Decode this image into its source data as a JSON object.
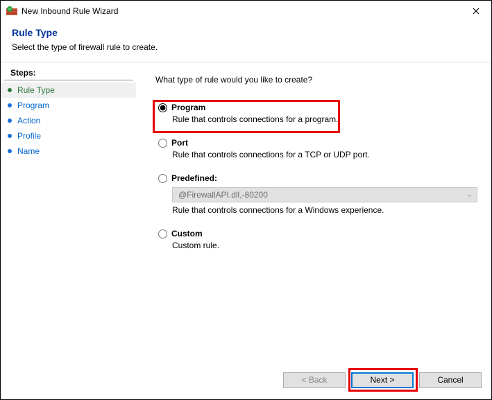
{
  "window": {
    "title": "New Inbound Rule Wizard"
  },
  "header": {
    "title": "Rule Type",
    "subtitle": "Select the type of firewall rule to create."
  },
  "sidebar": {
    "title": "Steps:",
    "items": [
      {
        "label": "Rule Type",
        "active": true,
        "link": false
      },
      {
        "label": "Program",
        "active": false,
        "link": true
      },
      {
        "label": "Action",
        "active": false,
        "link": true
      },
      {
        "label": "Profile",
        "active": false,
        "link": true
      },
      {
        "label": "Name",
        "active": false,
        "link": true
      }
    ]
  },
  "content": {
    "question": "What type of rule would you like to create?",
    "options": {
      "program": {
        "title": "Program",
        "desc": "Rule that controls connections for a program."
      },
      "port": {
        "title": "Port",
        "desc": "Rule that controls connections for a TCP or UDP port."
      },
      "predefined": {
        "title": "Predefined:",
        "dropdown": "@FirewallAPI.dll,-80200",
        "desc": "Rule that controls connections for a Windows experience."
      },
      "custom": {
        "title": "Custom",
        "desc": "Custom rule."
      }
    }
  },
  "footer": {
    "back": "< Back",
    "next": "Next >",
    "cancel": "Cancel"
  }
}
